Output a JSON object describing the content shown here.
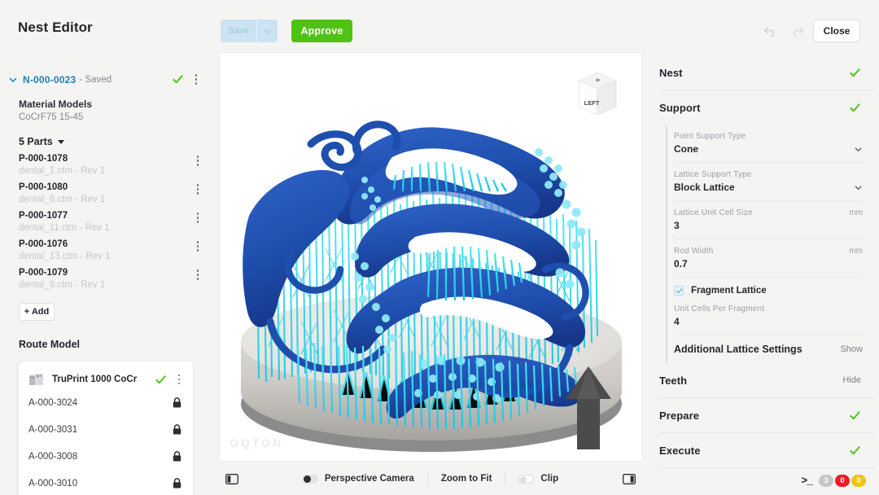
{
  "header": {
    "app_title": "Nest Editor",
    "save_label": "Save",
    "approve_label": "Approve",
    "close_label": "Close",
    "undo_icon": "undo-icon",
    "redo_icon": "redo-icon"
  },
  "sidebar": {
    "nest": {
      "id": "N-000-0023",
      "state": "- Saved",
      "status_icon": "check-icon"
    },
    "material": {
      "label": "Material Models",
      "value": "CoCrF75 15-45"
    },
    "parts_header": "5 Parts",
    "parts": [
      {
        "id": "P-000-1078",
        "file": "dental_1.ctm - Rev 1"
      },
      {
        "id": "P-000-1080",
        "file": "dental_6.ctm - Rev 1"
      },
      {
        "id": "P-000-1077",
        "file": "dental_11.ctm - Rev 1"
      },
      {
        "id": "P-000-1076",
        "file": "dental_13.ctm - Rev 1"
      },
      {
        "id": "P-000-1079",
        "file": "dental_9.ctm - Rev 1"
      }
    ],
    "add_label": "+ Add",
    "route_model_title": "Route Model",
    "printer": {
      "name": "TruPrint 1000 CoCr",
      "icon": "printer-icon",
      "builds": [
        {
          "id": "A-000-3024",
          "icon": "lock-icon"
        },
        {
          "id": "A-000-3031",
          "icon": "lock-icon"
        },
        {
          "id": "A-000-3008",
          "icon": "lock-icon"
        },
        {
          "id": "A-000-3010",
          "icon": "lock-icon"
        }
      ]
    }
  },
  "viewport": {
    "watermark": "OQTON",
    "viewcube_face": "LEFT",
    "bottom_bar": {
      "left_panel_icon": "panel-left-icon",
      "right_panel_icon": "panel-right-icon",
      "perspective_label": "Perspective Camera",
      "perspective_on": true,
      "zoom_to_fit_label": "Zoom to Fit",
      "clip_label": "Clip",
      "clip_on": false
    }
  },
  "right_panel": {
    "sections": {
      "nest": "Nest",
      "support": "Support",
      "prepare": "Prepare",
      "execute": "Execute"
    },
    "support_fields": [
      {
        "label": "Point Support Type",
        "value": "Cone",
        "unit": "",
        "type": "select"
      },
      {
        "label": "Lattice Support Type",
        "value": "Block Lattice",
        "unit": "",
        "type": "select"
      },
      {
        "label": "Lattice Unit Cell Size",
        "value": "3",
        "unit": "mm",
        "type": "number"
      },
      {
        "label": "Rod Width",
        "value": "0.7",
        "unit": "mm",
        "type": "number"
      }
    ],
    "fragment_lattice": {
      "label": "Fragment Lattice",
      "checked": true
    },
    "unit_cells_per_fragment": {
      "label": "Unit Cells Per Fragment",
      "value": "4"
    },
    "additional_lattice": {
      "label": "Additional Lattice Settings",
      "action": "Show"
    },
    "teeth": {
      "label": "Teeth",
      "action": "Hide"
    },
    "status_icon": "check-icon"
  },
  "console": {
    "prompt_icon": "terminal-icon",
    "badges": [
      {
        "count": "3",
        "color": "#c6c6c4",
        "kind": "info"
      },
      {
        "count": "0",
        "color": "#ed1c24",
        "kind": "error"
      },
      {
        "count": "0",
        "color": "#f2c31a",
        "kind": "warning"
      }
    ]
  },
  "colors": {
    "accent_green": "#4fc313",
    "accent_blue": "#1e7fb5",
    "model_blue": "#1f4fae",
    "support_cyan": "#2fd9ef",
    "background": "#f4f4f3"
  }
}
